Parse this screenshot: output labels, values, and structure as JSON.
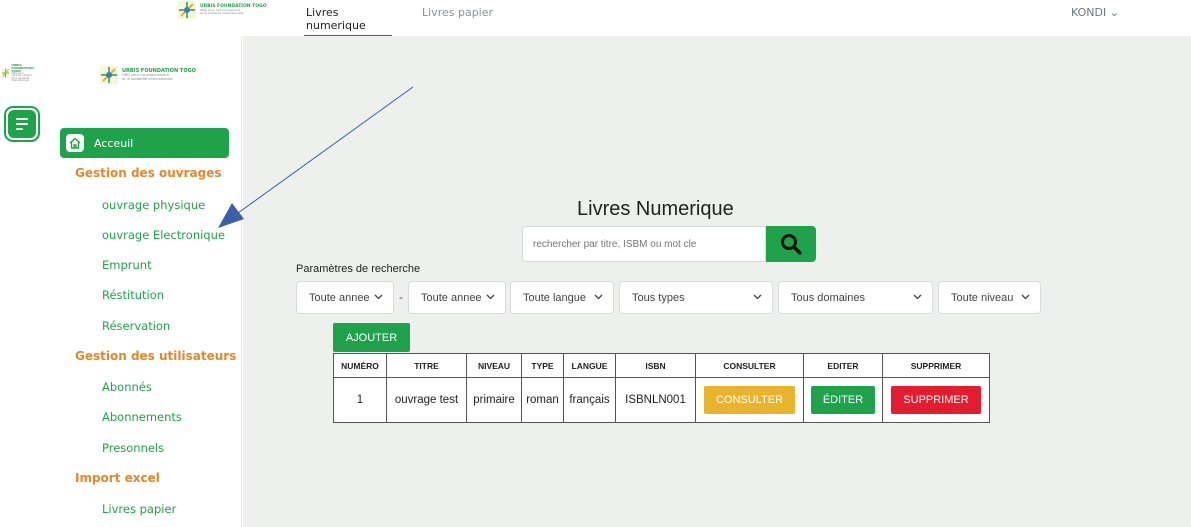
{
  "brand": {
    "name": "URBIS FOUNDATION TOGO",
    "tagline_line1": "ONG pour l'environnement",
    "tagline_line2": "et la solidarité internationale",
    "accent": "#1ea34a",
    "section_color": "#e3872a"
  },
  "topnav": {
    "tabs": [
      {
        "label": "Livres numerique",
        "active": true
      },
      {
        "label": "Livres papier",
        "active": false
      }
    ],
    "user": "KONDI ⌄"
  },
  "sidebar": {
    "home_label": "Acceuil",
    "sections": [
      {
        "title": "Gestion des ouvrages",
        "items": [
          "ouvrage physique",
          "ouvrage Electronique",
          "Emprunt",
          "Réstitution",
          "Réservation"
        ]
      },
      {
        "title": "Gestion des utilisateurs",
        "items": [
          "Abonnés",
          "Abonnements",
          "Presonnels"
        ]
      },
      {
        "title": "Import excel",
        "items": [
          "Livres papier"
        ]
      }
    ]
  },
  "main": {
    "title": "Livres Numerique",
    "search_placeholder": "rechercher par titre, ISBM ou mot cle",
    "params_label": "Paramètres de recherche",
    "filters": {
      "year_from": "Toute annee",
      "dash": "-",
      "year_to": "Toute annee",
      "language": "Toute langue",
      "type": "Tous types",
      "domain": "Tous domaines",
      "level": "Toute niveau"
    },
    "add_button": "AJOUTER",
    "table": {
      "headers": [
        "NUMÉRO",
        "TITRE",
        "NIVEAU",
        "TYPE",
        "LANGUE",
        "ISBN",
        "CONSULTER",
        "EDITER",
        "SUPPRIMER"
      ],
      "rows": [
        {
          "num": "1",
          "title": "ouvrage test",
          "level": "primaire",
          "type": "roman",
          "lang": "français",
          "isbn": "ISBNLN001",
          "consult": "CONSULTER",
          "edit": "ÉDITER",
          "delete": "SUPPRIMER"
        }
      ]
    }
  }
}
